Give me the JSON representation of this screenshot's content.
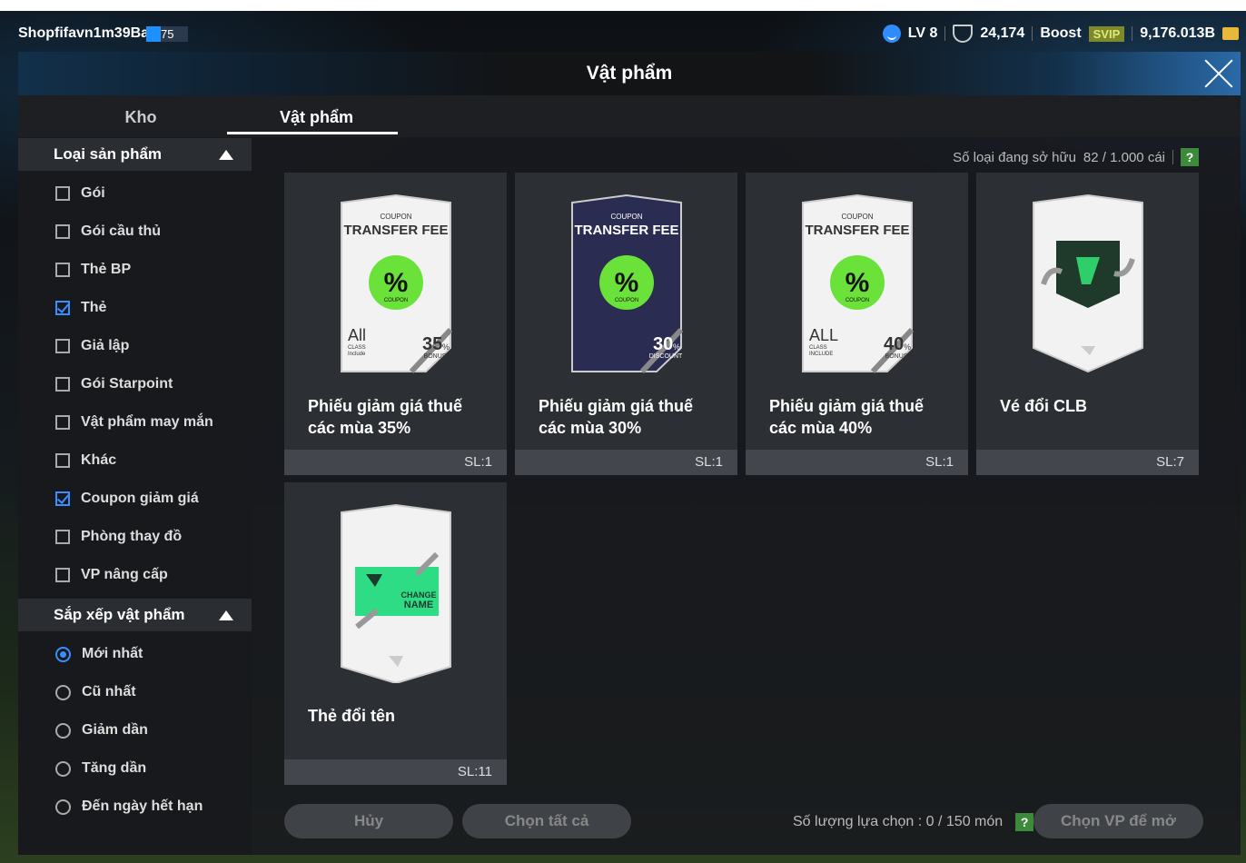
{
  "topbar": {
    "username": "Shopfifavn1m39Ba",
    "user_level": "75",
    "lv": "LV 8",
    "points": "24,174",
    "boost": "Boost",
    "svip": "SVIP",
    "currency": "9,176.013B"
  },
  "header": {
    "title": "Vật phẩm"
  },
  "tabs": [
    {
      "label": "Kho"
    },
    {
      "label": "Vật phẩm"
    }
  ],
  "sidebar": {
    "product_type": {
      "title": "Loại sản phẩm",
      "options": [
        {
          "label": "Gói",
          "checked": false
        },
        {
          "label": "Gói cầu thủ",
          "checked": false
        },
        {
          "label": "Thẻ BP",
          "checked": false
        },
        {
          "label": "Thẻ",
          "checked": true
        },
        {
          "label": "Giả lập",
          "checked": false
        },
        {
          "label": "Gói Starpoint",
          "checked": false
        },
        {
          "label": "Vật phẩm may mắn",
          "checked": false
        },
        {
          "label": "Khác",
          "checked": false
        },
        {
          "label": "Coupon giảm giá",
          "checked": true
        },
        {
          "label": "Phòng thay đồ",
          "checked": false
        },
        {
          "label": "VP nâng cấp",
          "checked": false
        }
      ]
    },
    "sort": {
      "title": "Sắp xếp vật phẩm",
      "options": [
        {
          "label": "Mới nhất",
          "selected": true
        },
        {
          "label": "Cũ nhất",
          "selected": false
        },
        {
          "label": "Giảm dần",
          "selected": false
        },
        {
          "label": "Tăng dần",
          "selected": false
        },
        {
          "label": "Đến ngày hết hạn",
          "selected": false
        }
      ]
    }
  },
  "owned": {
    "label": "Số loại đang sở hữu",
    "value": "82 / 1.000 cái",
    "help": "?"
  },
  "items": [
    {
      "name": "Phiếu giảm giá thuế các mùa 35%",
      "qty": "SL:1",
      "card": {
        "small": "COUPON",
        "title": "TRANSFER FEE",
        "pct": "35",
        "pct_sign": "%",
        "sub": "BONUS",
        "left": "All",
        "left_sub": "CLASS",
        "left_sub2": "Include",
        "stamp": "COUPON",
        "theme": "light"
      }
    },
    {
      "name": "Phiếu giảm giá thuế các mùa 30%",
      "qty": "SL:1",
      "card": {
        "small": "COUPON",
        "title": "TRANSFER FEE",
        "pct": "30",
        "pct_sign": "%",
        "sub": "DISCOUNT",
        "left": "",
        "left_sub": "",
        "left_sub2": "",
        "stamp": "COUPON",
        "theme": "dark"
      }
    },
    {
      "name": "Phiếu giảm giá thuế các mùa 40%",
      "qty": "SL:1",
      "card": {
        "small": "COUPON",
        "title": "TRANSFER FEE",
        "pct": "40",
        "pct_sign": "%",
        "sub": "BONUS",
        "left": "ALL",
        "left_sub": "CLASS",
        "left_sub2": "INCLUDE",
        "stamp": "COUPON",
        "theme": "light"
      }
    },
    {
      "name": "Vé đổi CLB",
      "qty": "SL:7",
      "card": {
        "theme": "club"
      }
    },
    {
      "name": "Thẻ đổi tên",
      "qty": "SL:11",
      "card": {
        "theme": "rename",
        "line1": "CHANGE",
        "line2": "NAME"
      }
    }
  ],
  "footer": {
    "cancel": "Hủy",
    "select_all": "Chọn tất cả",
    "count_label": "Số lượng lựa chọn : 0 / 150 món",
    "help": "?",
    "open": "Chọn VP để mở"
  }
}
